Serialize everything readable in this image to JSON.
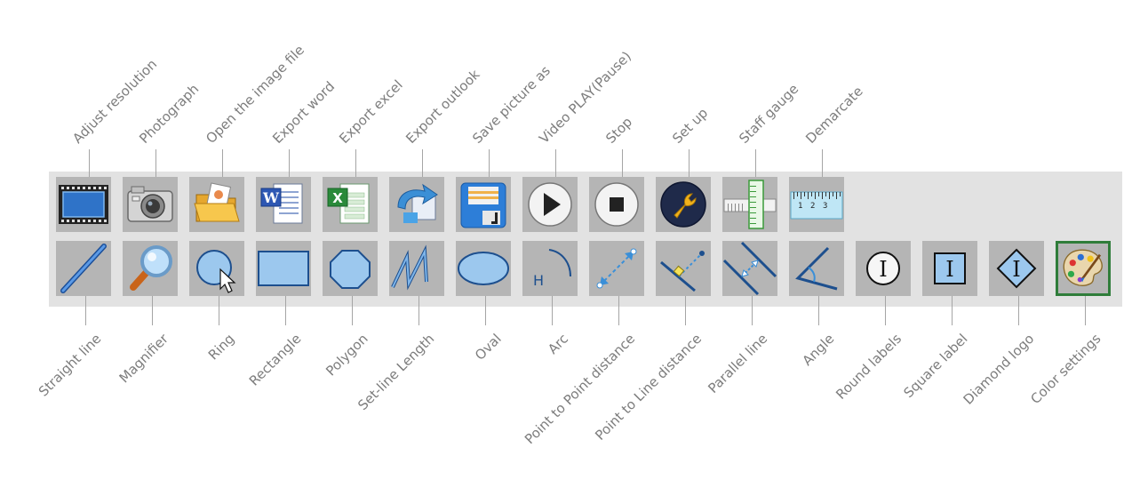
{
  "toolbar": {
    "top_row": [
      {
        "label": "Adjust resolution",
        "icon": "film-icon"
      },
      {
        "label": "Photograph",
        "icon": "camera-icon"
      },
      {
        "label": "Open the image file",
        "icon": "open-folder-icon"
      },
      {
        "label": "Export word",
        "icon": "word-document-icon"
      },
      {
        "label": "Export excel",
        "icon": "excel-document-icon"
      },
      {
        "label": "Export outlook",
        "icon": "outlook-arrow-icon"
      },
      {
        "label": "Save picture as",
        "icon": "floppy-disk-icon"
      },
      {
        "label": "Video PLAY(Pause)",
        "icon": "play-icon"
      },
      {
        "label": "Stop",
        "icon": "stop-icon"
      },
      {
        "label": "Set up",
        "icon": "wrench-icon"
      },
      {
        "label": "Staff gauge",
        "icon": "staff-gauge-icon"
      },
      {
        "label": "Demarcate",
        "icon": "ruler-icon",
        "ruler_marks": "1 2 3"
      }
    ],
    "bottom_row": [
      {
        "label": "Straight line",
        "icon": "straight-line-icon"
      },
      {
        "label": "Magnifier",
        "icon": "magnifier-icon"
      },
      {
        "label": "Ring",
        "icon": "ring-icon"
      },
      {
        "label": "Rectangle",
        "icon": "rectangle-icon"
      },
      {
        "label": "Polygon",
        "icon": "polygon-icon"
      },
      {
        "label": "Set-line Length",
        "icon": "set-line-length-icon"
      },
      {
        "label": "Oval",
        "icon": "oval-icon"
      },
      {
        "label": "Arc",
        "icon": "arc-icon",
        "glyph": "H"
      },
      {
        "label": "Point to Point distance",
        "icon": "point-to-point-icon"
      },
      {
        "label": "Point to Line distance",
        "icon": "point-to-line-icon"
      },
      {
        "label": "Parallel line",
        "icon": "parallel-line-icon"
      },
      {
        "label": "Angle",
        "icon": "angle-icon"
      },
      {
        "label": "Round labels",
        "icon": "round-label-icon",
        "glyph": "I"
      },
      {
        "label": "Square label",
        "icon": "square-label-icon",
        "glyph": "I"
      },
      {
        "label": "Diamond logo",
        "icon": "diamond-label-icon",
        "glyph": "I"
      },
      {
        "label": "Color settings",
        "icon": "palette-icon",
        "selected": true
      }
    ]
  },
  "colors": {
    "toolbar_background": "#e2e2e2",
    "button_background": "#b5b5b5",
    "selected_border": "#2f7d3a",
    "callout_text": "#7d7d7d",
    "icon_blue": "#2f73c8"
  }
}
